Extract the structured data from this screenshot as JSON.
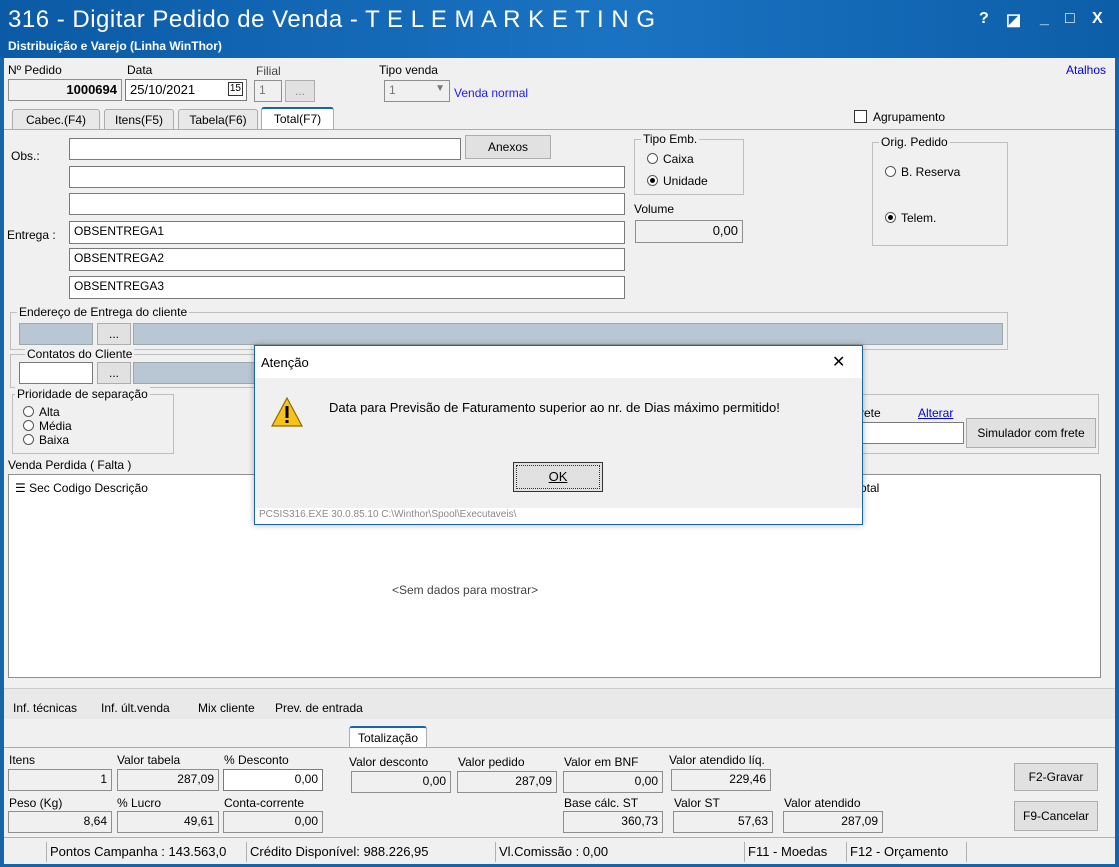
{
  "window": {
    "title": "316 - Digitar Pedido de Venda - T E L E M A R K E T I N G",
    "subtitle": "Distribuição e Varejo (Linha WinThor)",
    "controls": {
      "help": "?",
      "restore": "◪",
      "minimize": "_",
      "maximize": "□",
      "close": "X"
    }
  },
  "header": {
    "nr_pedido_label": "Nº Pedido",
    "nr_pedido": "1000694",
    "data_label": "Data",
    "data": "25/10/2021",
    "filial_label": "Filial",
    "filial": "1",
    "filial_btn": "...",
    "tipo_venda_label": "Tipo venda",
    "tipo_venda": "1",
    "tipo_venda_desc": "Venda normal",
    "atalhos": "Atalhos",
    "agrupamento": "Agrupamento"
  },
  "tabs": [
    {
      "label": "Cabec.(F4)"
    },
    {
      "label": "Itens(F5)"
    },
    {
      "label": "Tabela(F6)"
    },
    {
      "label": "Total(F7)"
    }
  ],
  "total": {
    "obs_label": "Obs.:",
    "obs": [
      "",
      "",
      ""
    ],
    "anexos": "Anexos",
    "entrega_label": "Entrega :",
    "entrega": [
      "OBSENTREGA1",
      "OBSENTREGA2",
      "OBSENTREGA3"
    ],
    "tipo_emb": {
      "title": "Tipo Emb.",
      "caixa": "Caixa",
      "unidade": "Unidade"
    },
    "volume_label": "Volume",
    "volume": "0,00",
    "orig_pedido": {
      "title": "Orig. Pedido",
      "reserva": "B. Reserva",
      "telem": "Telem."
    },
    "endereco_title": "Endereço de Entrega do cliente",
    "endereco_btn": "...",
    "contatos_title": "Contatos do Cliente",
    "contatos_btn": "...",
    "prioridade": {
      "title": "Prioridade de separação",
      "alta": "Alta",
      "media": "Média",
      "baixa": "Baixa"
    },
    "frete_label": "rete",
    "alterar": "Alterar",
    "simulador": "Simulador com frete",
    "venda_perdida": "Venda Perdida ( Falta )",
    "grid_cols": {
      "sec": "Sec",
      "codigo": "Codigo",
      "descricao": "Descrição",
      "total": "otal"
    },
    "grid_empty": "<Sem dados para mostrar>"
  },
  "bottom_links": [
    "Inf. técnicas",
    "Inf. últ.venda",
    "Mix cliente",
    "Prev. de entrada"
  ],
  "totalizacao": {
    "tab": "Totalização",
    "itens_label": "Itens",
    "itens": "1",
    "valor_tabela_label": "Valor tabela",
    "valor_tabela": "287,09",
    "desconto_pct_label": "% Desconto",
    "desconto_pct": "0,00",
    "valor_desconto_label": "Valor desconto",
    "valor_desconto": "0,00",
    "valor_pedido_label": "Valor pedido",
    "valor_pedido": "287,09",
    "valor_bnf_label": "Valor em BNF",
    "valor_bnf": "0,00",
    "valor_atendido_liq_label": "Valor atendido líq.",
    "valor_atendido_liq": "229,46",
    "peso_label": "Peso (Kg)",
    "peso": "8,64",
    "lucro_label": "% Lucro",
    "lucro": "49,61",
    "conta_corrente_label": "Conta-corrente",
    "conta_corrente": "0,00",
    "base_st_label": "Base cálc. ST",
    "base_st": "360,73",
    "valor_st_label": "Valor ST",
    "valor_st": "57,63",
    "valor_atendido_label": "Valor atendido",
    "valor_atendido": "287,09",
    "gravar": "F2-Gravar",
    "cancelar": "F9-Cancelar"
  },
  "status": {
    "pontos": "Pontos Campanha : 143.563,0",
    "credito": "Crédito Disponível: 988.226,95",
    "comissao": "Vl.Comissão : 0,00",
    "moedas": "F11 - Moedas",
    "orcamento": "F12 - Orçamento"
  },
  "dialog": {
    "title": "Atenção",
    "close": "✕",
    "message": "Data para Previsão de Faturamento superior ao nr. de Dias máximo permitido!",
    "ok": "OK",
    "footer": "PCSIS316.EXE 30.0.85.10 C:\\Winthor\\Spool\\Executaveis\\"
  }
}
